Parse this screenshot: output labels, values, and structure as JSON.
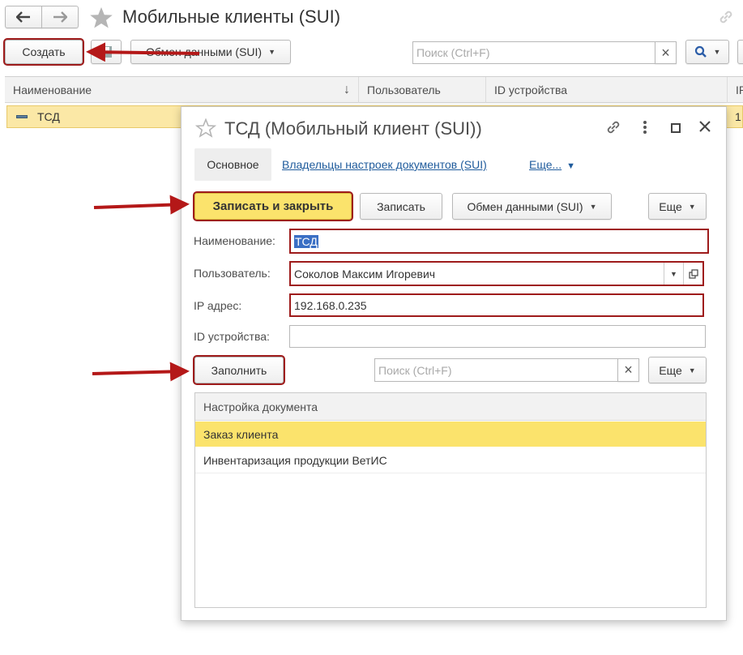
{
  "window": {
    "title": "Мобильные клиенты (SUI)",
    "create_label": "Создать",
    "exchange_label": "Обмен данными (SUI)",
    "search_placeholder": "Поиск (Ctrl+F)",
    "clear_glyph": "×",
    "search_glyph": "🔍"
  },
  "table": {
    "columns": [
      "Наименование",
      "Пользователь",
      "ID устройства",
      "IP"
    ],
    "sort_glyph": "↓",
    "rows": [
      {
        "name": "ТСД",
        "ip_partial": "1"
      }
    ]
  },
  "dialog": {
    "title": "ТСД (Мобильный клиент (SUI))",
    "tabs": {
      "main": "Основное",
      "owners": "Владельцы настроек документов (SUI)",
      "more": "Еще..."
    },
    "buttons": {
      "save_close": "Записать и закрыть",
      "save": "Записать",
      "exchange": "Обмен данными (SUI)",
      "more": "Еще"
    },
    "fields": {
      "name_label": "Наименование:",
      "name_value": "ТСД",
      "user_label": "Пользователь:",
      "user_value": "Соколов Максим Игоревич",
      "ip_label": "IP адрес:",
      "ip_value": "192.168.0.235",
      "device_label": "ID устройства:",
      "device_value": ""
    },
    "fill_label": "Заполнить",
    "search_placeholder": "Поиск (Ctrl+F)",
    "more2": "Еще",
    "doc_table": {
      "header": "Настройка документа",
      "rows": [
        "Заказ клиента",
        "Инвентаризация продукции ВетИС"
      ]
    }
  },
  "colors": {
    "accent_yellow": "#fbe36c",
    "row_highlight": "#fbe8a6",
    "annotation_red": "#b41818",
    "link": "#1f5b9c"
  }
}
